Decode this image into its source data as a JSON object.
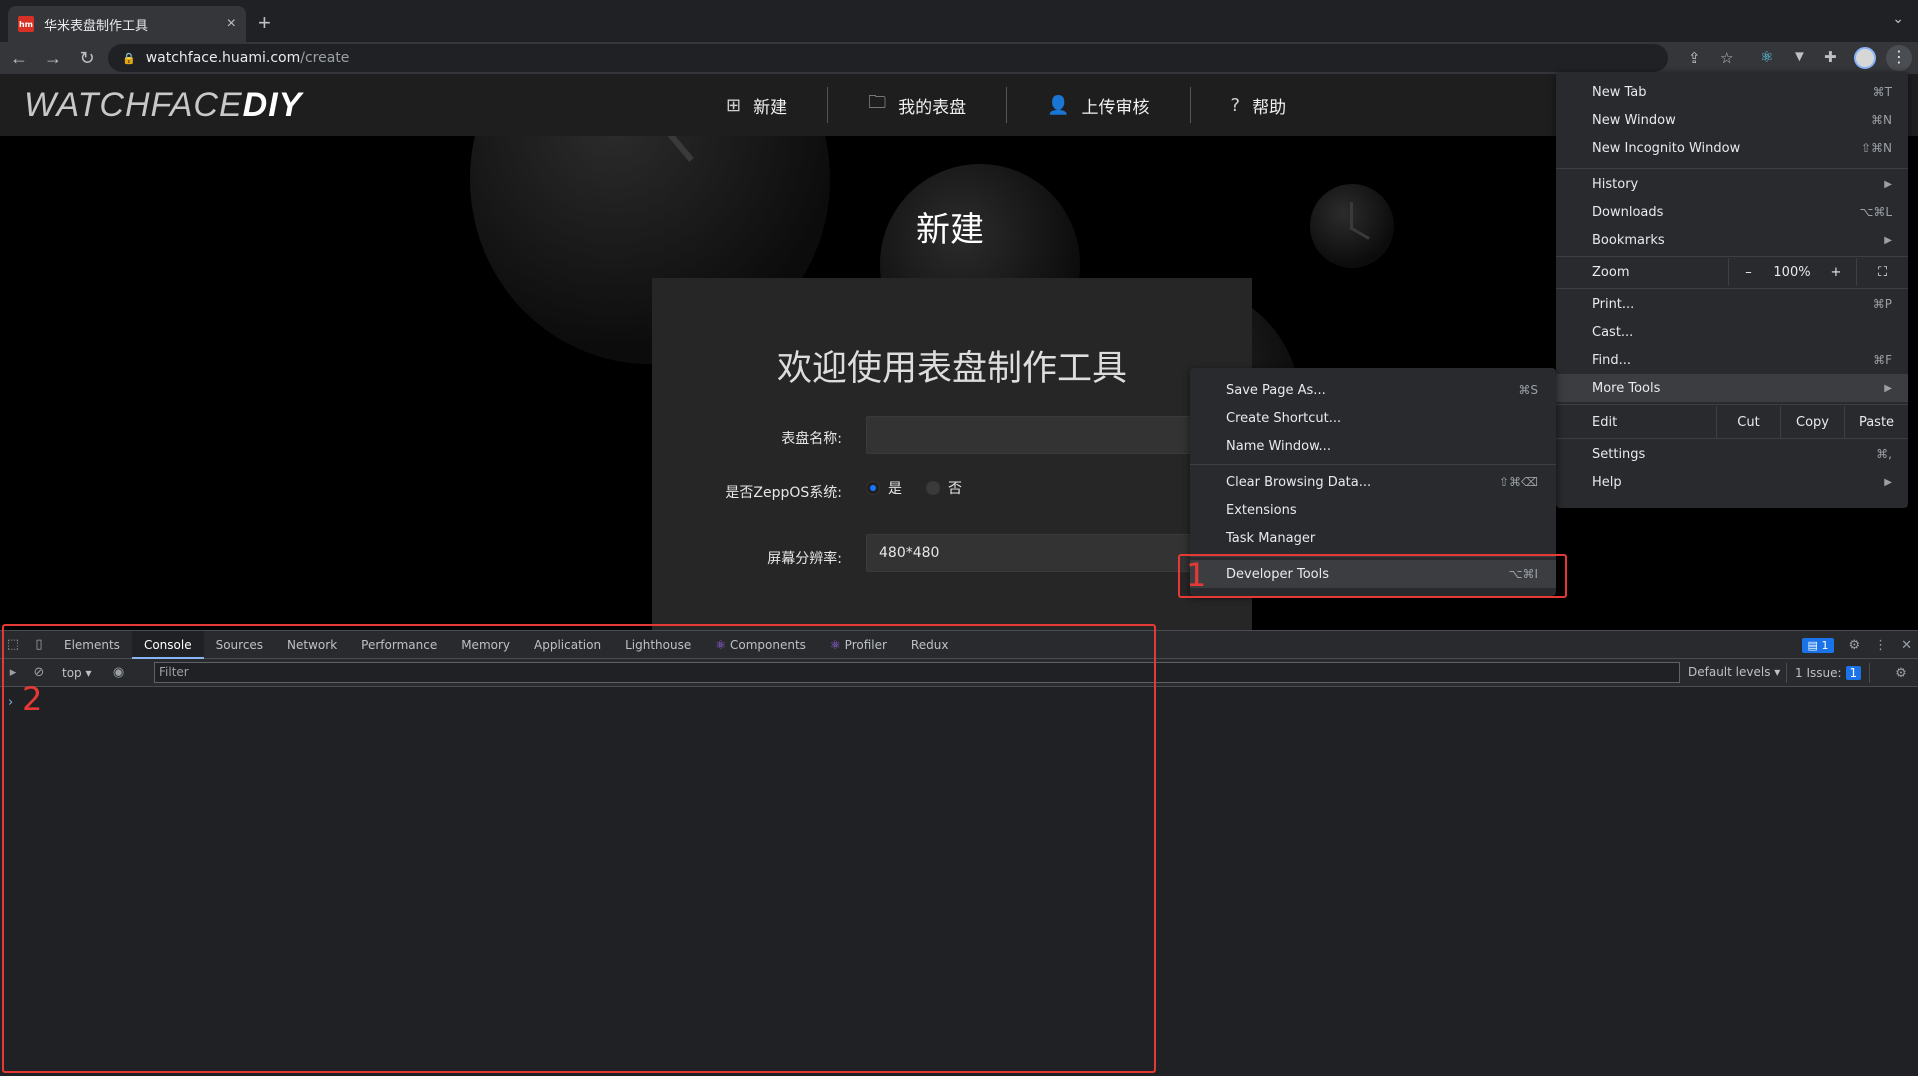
{
  "browser": {
    "tab_title": "华米表盘制作工具",
    "favicon_text": "hm",
    "url_host": "watchface.huami.com",
    "url_path": "/create",
    "icons": [
      "back-icon",
      "forward-icon",
      "reload-icon",
      "lock-icon",
      "share-icon",
      "star-icon",
      "extensions-icon",
      "kebab-menu-icon"
    ]
  },
  "site": {
    "logo_light": "WATCHFACE",
    "logo_bold": "DIY",
    "nav": [
      {
        "label": "新建",
        "icon": "plus-square-icon"
      },
      {
        "label": "我的表盘",
        "icon": "folder-icon"
      },
      {
        "label": "上传审核",
        "icon": "user-icon"
      },
      {
        "label": "帮助",
        "icon": "help-circle-icon"
      }
    ],
    "page_title": "新建",
    "welcome": "欢迎使用表盘制作工具",
    "form": {
      "name_label": "表盘名称:",
      "name_value": "",
      "zepp_label": "是否ZeppOS系统:",
      "yes": "是",
      "no": "否",
      "resolution_label": "屏幕分辨率:",
      "resolution_value": "480*480"
    }
  },
  "chrome_menu": {
    "new_tab": "New Tab",
    "new_tab_sc": "⌘T",
    "new_window": "New Window",
    "new_window_sc": "⌘N",
    "incognito": "New Incognito Window",
    "incognito_sc": "⇧⌘N",
    "history": "History",
    "downloads": "Downloads",
    "downloads_sc": "⌥⌘L",
    "bookmarks": "Bookmarks",
    "zoom": "Zoom",
    "zoom_minus": "–",
    "zoom_value": "100%",
    "zoom_plus": "+",
    "print": "Print...",
    "print_sc": "⌘P",
    "cast": "Cast...",
    "find": "Find...",
    "find_sc": "⌘F",
    "more_tools": "More Tools",
    "edit": "Edit",
    "cut": "Cut",
    "copy": "Copy",
    "paste": "Paste",
    "settings": "Settings",
    "settings_sc": "⌘,",
    "help": "Help"
  },
  "more_tools_menu": {
    "save_page": "Save Page As...",
    "save_page_sc": "⌘S",
    "create_shortcut": "Create Shortcut...",
    "name_window": "Name Window...",
    "clear_data": "Clear Browsing Data...",
    "clear_data_sc": "⇧⌘⌫",
    "extensions": "Extensions",
    "task_manager": "Task Manager",
    "dev_tools": "Developer Tools",
    "dev_tools_sc": "⌥⌘I"
  },
  "devtools": {
    "tabs": [
      "Elements",
      "Console",
      "Sources",
      "Network",
      "Performance",
      "Memory",
      "Application",
      "Lighthouse",
      "Components",
      "Profiler",
      "Redux"
    ],
    "active_tab": "Console",
    "msg_count": "1",
    "context": "top",
    "filter_placeholder": "Filter",
    "levels": "Default levels",
    "issues_label": "1 Issue:",
    "issues_count": "1",
    "prompt": "›"
  },
  "annotations": {
    "one": "1",
    "two": "2"
  },
  "colors": {
    "annotation": "#e53935",
    "accent": "#1677ff",
    "devtools_accent": "#8ab4f8"
  }
}
